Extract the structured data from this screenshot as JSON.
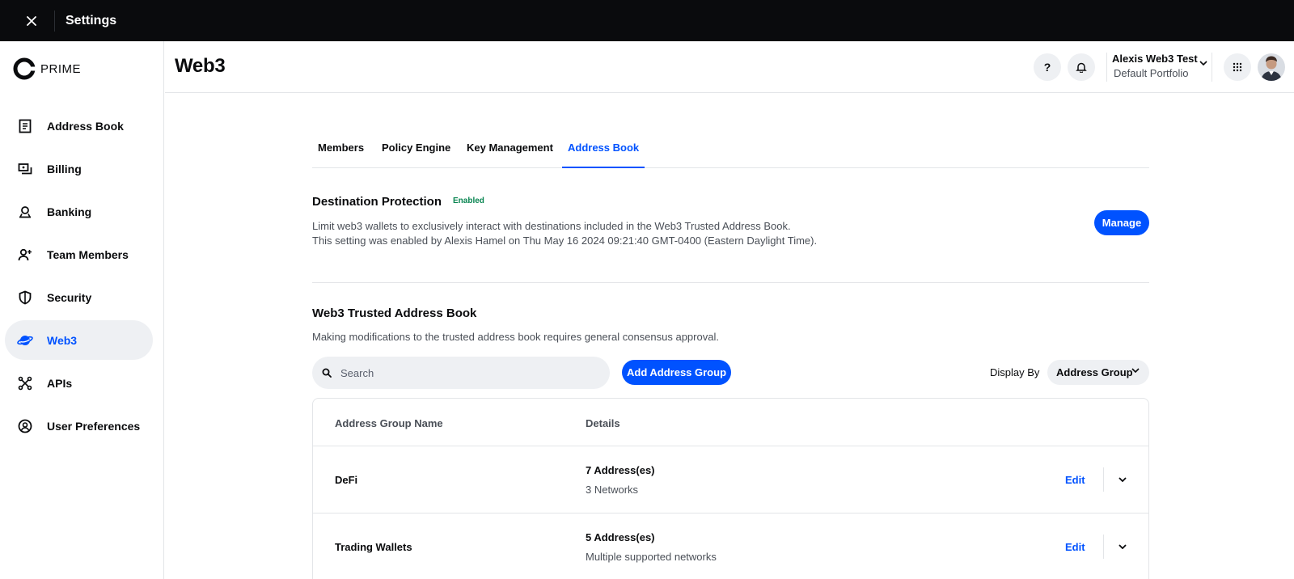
{
  "topbar": {
    "title": "Settings",
    "close_icon": "close-icon"
  },
  "brand": {
    "name": "PRIME"
  },
  "sidebar": {
    "items": [
      {
        "label": "Address Book",
        "icon": "address-book-icon"
      },
      {
        "label": "Billing",
        "icon": "billing-icon"
      },
      {
        "label": "Banking",
        "icon": "banking-icon"
      },
      {
        "label": "Team Members",
        "icon": "team-members-icon"
      },
      {
        "label": "Security",
        "icon": "shield-icon"
      },
      {
        "label": "Web3",
        "icon": "planet-icon",
        "active": true
      },
      {
        "label": "APIs",
        "icon": "api-icon"
      },
      {
        "label": "User Preferences",
        "icon": "user-circle-icon"
      }
    ]
  },
  "header": {
    "title": "Web3",
    "help_label": "?",
    "account_name": "Alexis Web3 Test",
    "portfolio": "Default Portfolio"
  },
  "tabs": [
    {
      "label": "Members"
    },
    {
      "label": "Policy Engine"
    },
    {
      "label": "Key Management"
    },
    {
      "label": "Address Book",
      "active": true
    }
  ],
  "destination_protection": {
    "title": "Destination Protection",
    "status": "Enabled",
    "description_line1": "Limit web3 wallets to exclusively interact with destinations included in the Web3 Trusted Address Book.",
    "description_line2": "This setting was enabled by Alexis Hamel on Thu May 16 2024 09:21:40 GMT-0400 (Eastern Daylight Time).",
    "manage_label": "Manage"
  },
  "trusted_book": {
    "title": "Web3 Trusted Address Book",
    "description": "Making modifications to the trusted address book requires general consensus approval.",
    "search_placeholder": "Search",
    "add_label": "Add Address Group",
    "display_by_label": "Display By",
    "display_by_value": "Address Group"
  },
  "table": {
    "columns": [
      "Address Group Name",
      "Details"
    ],
    "rows": [
      {
        "name": "DeFi",
        "count": "7 Address(es)",
        "networks": "3 Networks",
        "edit": "Edit"
      },
      {
        "name": "Trading Wallets",
        "count": "5 Address(es)",
        "networks": "Multiple supported networks",
        "edit": "Edit"
      }
    ]
  },
  "colors": {
    "accent": "#0052ff",
    "topbar": "#0a0b0d",
    "success": "#098551",
    "surface": "#eef0f3"
  }
}
